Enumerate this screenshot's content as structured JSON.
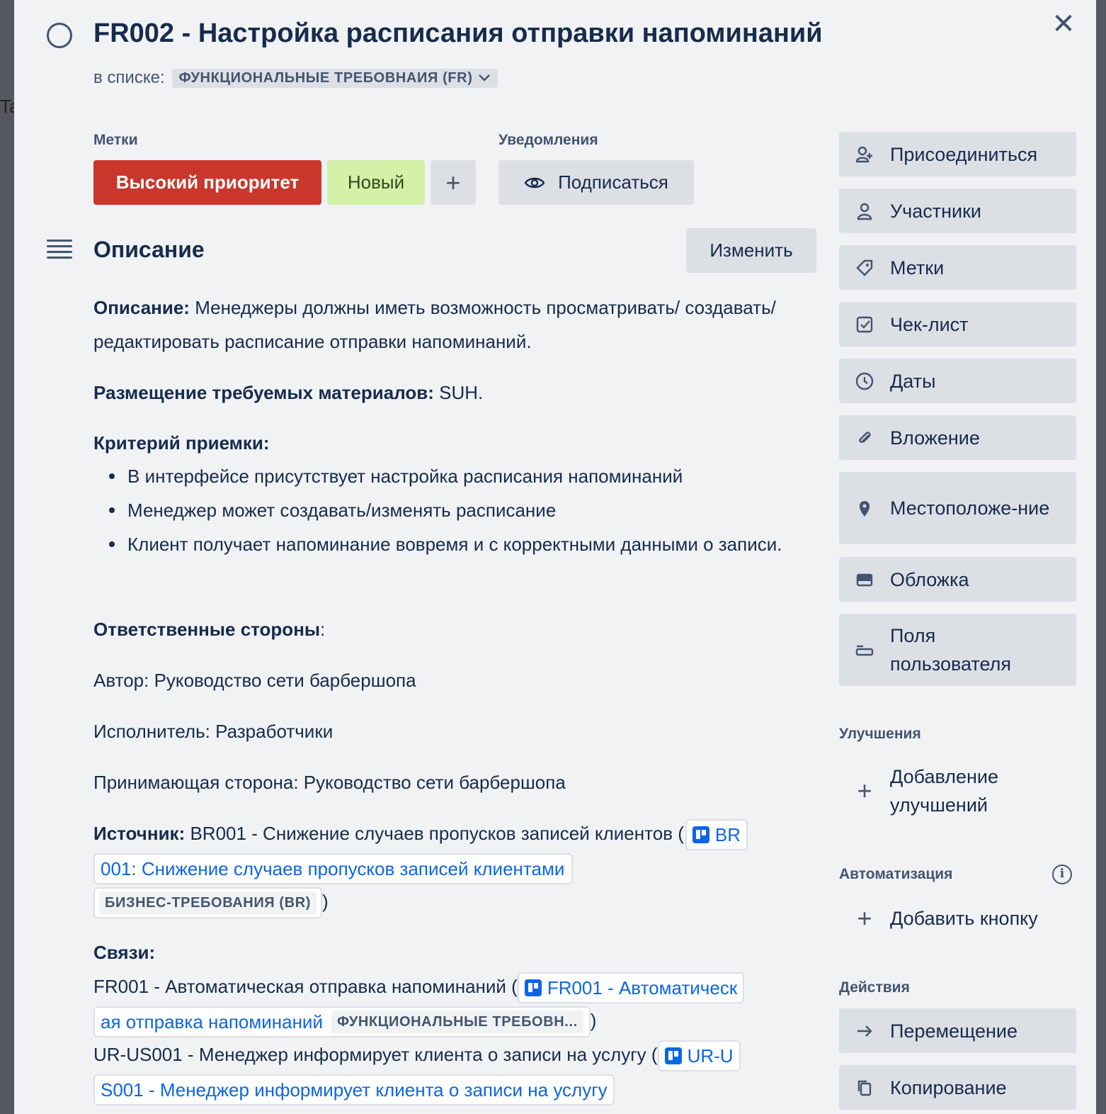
{
  "backdrop": {
    "fragment": "Ta"
  },
  "card": {
    "title": "FR002 - Настройка расписания отправки напоминаний",
    "in_list_label": "в списке:",
    "list_name": "ФУНКЦИОНАЛЬНЫЕ ТРЕБОВНАИЯ (FR)"
  },
  "labels": {
    "heading": "Метки",
    "items": [
      {
        "text": "Высокий приоритет",
        "color": "#c9372c"
      },
      {
        "text": "Новый",
        "color": "#d3f1a7"
      }
    ],
    "add": "+"
  },
  "notifications": {
    "heading": "Уведомления",
    "watch_label": "Подписаться"
  },
  "description": {
    "heading": "Описание",
    "edit_label": "Изменить",
    "p1_label": "Описание:",
    "p1_text": " Менеджеры должны иметь возможность просматривать/ создавать/редактировать расписание отправки напоминаний.",
    "p2_label": "Размещение требуемых материалов:",
    "p2_text": " SUH.",
    "criteria_label": "Критерий приемки:",
    "criteria": [
      "В интерфейсе присутствует настройка расписания напоминаний",
      "Менеджер может создавать/изменять расписание",
      "Клиент получает напоминание вовремя и с корректными данными о записи."
    ],
    "parties_label": "Ответственные стороны",
    "parties_colon": ":",
    "author": "Автор: Руководство сети барбершопа",
    "executor": "Исполнитель: Разработчики",
    "acceptor": "Принимающая сторона: Руководство сети барбершопа",
    "source_label": "Источник:",
    "source_text": " BR001 - Снижение случаев пропусков записей клиентов (",
    "source_link_a": "BR",
    "source_link_b": "001: Снижение случаев пропусков записей клиентами",
    "source_tag": "БИЗНЕС-ТРЕБОВАНИЯ (BR)",
    "close_paren": ")",
    "links_label": "Связи:",
    "link1_text": "FR001 - Автоматическая отправка напоминаний (",
    "link1_a": "FR001 - Автоматическ",
    "link1_b": "ая отправка напоминаний",
    "link1_tag": "ФУНКЦИОНАЛЬНЫЕ ТРЕБОВН...",
    "link2_text": "UR-US001 - Менеджер информирует клиента о записи на услугу (",
    "link2_a": "UR-U",
    "link2_b": "S001 - Менеджер информирует клиента о записи на услугу"
  },
  "sidebar": {
    "buttons": [
      {
        "label": "Присоединиться",
        "icon": "add-person-icon"
      },
      {
        "label": "Участники",
        "icon": "person-icon"
      },
      {
        "label": "Метки",
        "icon": "tag-icon"
      },
      {
        "label": "Чек-лист",
        "icon": "checkbox-icon"
      },
      {
        "label": "Даты",
        "icon": "clock-icon"
      },
      {
        "label": "Вложение",
        "icon": "paperclip-icon"
      },
      {
        "label": "Местоположе-ние",
        "icon": "location-pin-icon"
      },
      {
        "label": "Обложка",
        "icon": "cover-icon"
      },
      {
        "label": "Поля пользователя",
        "icon": "custom-fields-icon"
      }
    ],
    "powerups_heading": "Улучшения",
    "add_powerups": "Добавление улучшений",
    "automation_heading": "Автоматизация",
    "add_button": "Добавить кнопку",
    "actions_heading": "Действия",
    "move": "Перемещение",
    "copy": "Копирование"
  }
}
